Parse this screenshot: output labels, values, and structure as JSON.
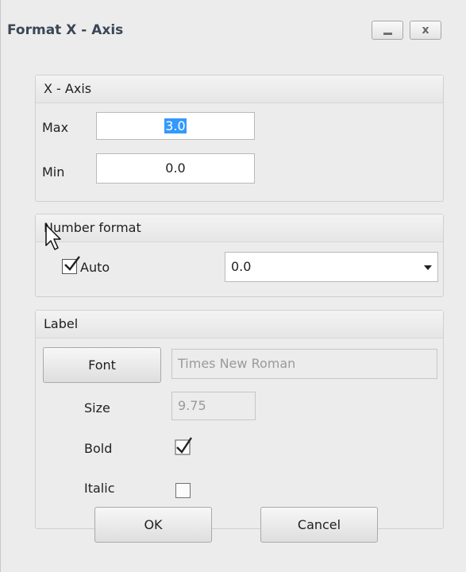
{
  "window": {
    "title": "Format X - Axis",
    "minimize_label": "_",
    "close_label": "x"
  },
  "axis_group": {
    "title": "X - Axis",
    "max_label": "Max",
    "max_value": "3.0",
    "min_label": "Min",
    "min_value": "0.0"
  },
  "number_format_group": {
    "title": "Number format",
    "auto_label": "Auto",
    "auto_checked": true,
    "format_value": "0.0"
  },
  "label_group": {
    "title": "Label",
    "font_button": "Font",
    "font_value": "Times New Roman",
    "size_label": "Size",
    "size_value": "9.75",
    "bold_label": "Bold",
    "bold_checked": true,
    "italic_label": "Italic",
    "italic_checked": false
  },
  "actions": {
    "ok_label": "OK",
    "cancel_label": "Cancel"
  }
}
